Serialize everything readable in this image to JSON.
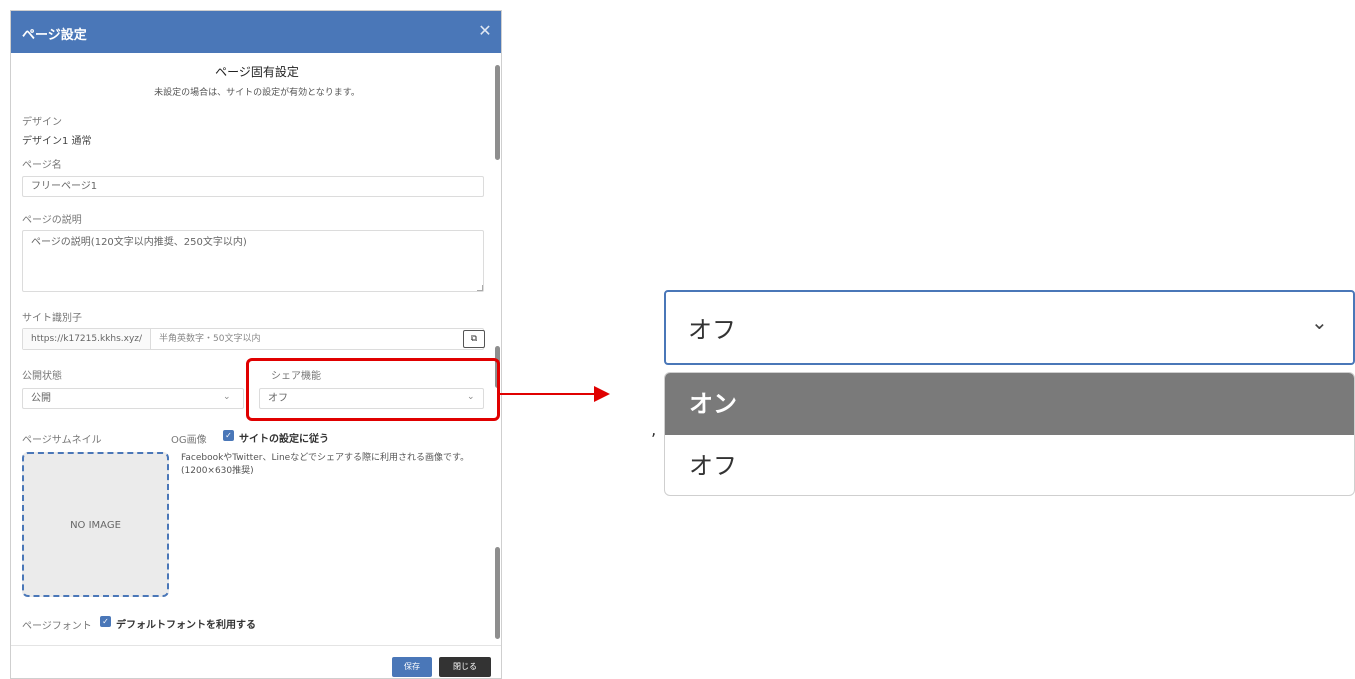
{
  "modal": {
    "title": "ページ設定",
    "close_icon": "close-icon",
    "section_title": "ページ固有設定",
    "section_subtitle": "未設定の場合は、サイトの設定が有効となります。",
    "design": {
      "label": "デザイン",
      "value": "デザイン1 通常"
    },
    "page_name": {
      "label": "ページ名",
      "value": "フリーページ1"
    },
    "page_description": {
      "label": "ページの説明",
      "placeholder": "ページの説明(120文字以内推奨、250文字以内)"
    },
    "site_identifier": {
      "label": "サイト識別子",
      "prefix": "https://k17215.kkhs.xyz/",
      "placeholder": "半角英数字・50文字以内",
      "copy_icon": "copy-icon"
    },
    "publish_status": {
      "label": "公開状態",
      "value": "公開"
    },
    "share_function": {
      "label": "シェア機能",
      "value": "オフ"
    },
    "page_thumbnail": {
      "label": "ページサムネイル",
      "no_image": "NO IMAGE"
    },
    "og_image": {
      "label": "OG画像",
      "checkbox_label": "サイトの設定に従う",
      "checked": true,
      "description": "FacebookやTwitter、Lineなどでシェアする際に利用される画像です。(1200×630推奨)"
    },
    "page_font": {
      "label": "ページフォント",
      "checkbox_label": "デフォルトフォントを利用する",
      "checked": true
    },
    "buttons": {
      "save": "保存",
      "close": "閉じる"
    }
  },
  "zoom_dropdown": {
    "selected": "オフ",
    "options": [
      "オン",
      "オフ"
    ],
    "highlighted_option": "オン"
  },
  "colors": {
    "header_bg": "#4a77b8",
    "highlight": "#e00000",
    "option_highlight": "#7a7a7a"
  }
}
